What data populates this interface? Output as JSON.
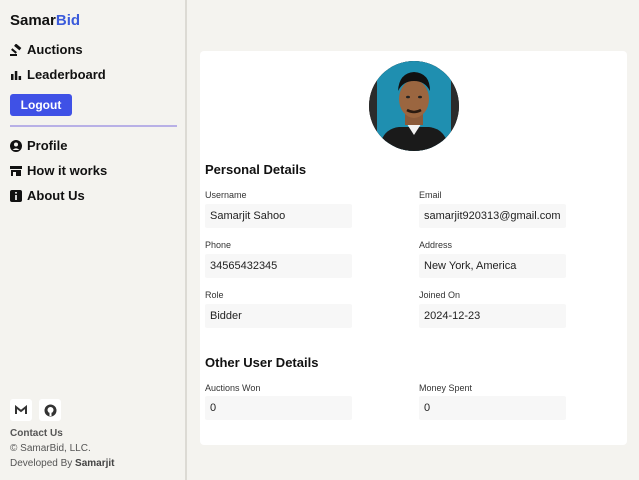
{
  "brand": {
    "part1": "Samar",
    "part2": "Bid"
  },
  "nav": {
    "auctions": "Auctions",
    "leaderboard": "Leaderboard",
    "logout": "Logout",
    "profile": "Profile",
    "how_it_works": "How it works",
    "about_us": "About Us"
  },
  "footer": {
    "contact": "Contact Us",
    "copyright": "© SamarBid, LLC.",
    "developed_prefix": "Developed By ",
    "developer": "Samarjit"
  },
  "icons": {
    "auctions": "gavel-icon",
    "leaderboard": "bar-chart-icon",
    "profile": "user-circle-icon",
    "how_it_works": "shop-icon",
    "about_us": "info-icon",
    "gmail": "gmail-icon",
    "github": "github-icon"
  },
  "colors": {
    "brand_accent": "#3b5bdb",
    "logout_button": "#3f51e6"
  },
  "profile": {
    "personal_title": "Personal Details",
    "username_label": "Username",
    "username": "Samarjit Sahoo",
    "email_label": "Email",
    "email": "samarjit920313@gmail.com",
    "phone_label": "Phone",
    "phone": "34565432345",
    "address_label": "Address",
    "address": "New York, America",
    "role_label": "Role",
    "role": "Bidder",
    "joined_label": "Joined On",
    "joined": "2024-12-23",
    "other_title": "Other User Details",
    "auctions_won_label": "Auctions Won",
    "auctions_won": "0",
    "money_spent_label": "Money Spent",
    "money_spent": "0"
  }
}
